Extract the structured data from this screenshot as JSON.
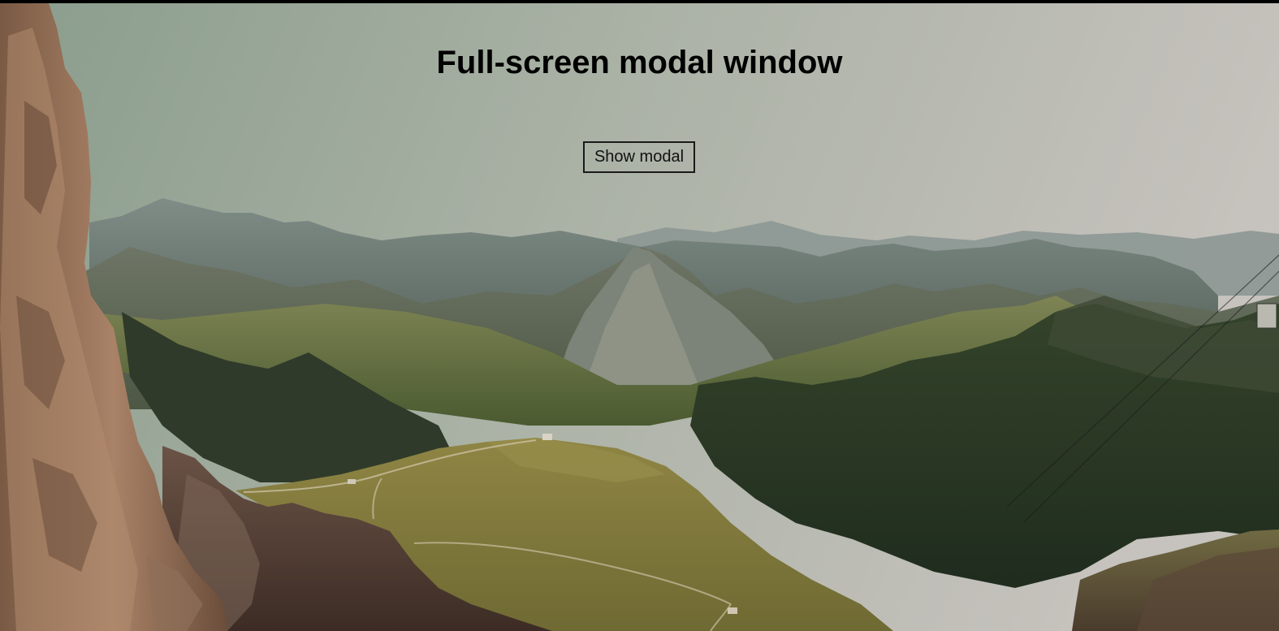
{
  "page": {
    "title": "Full-screen modal window",
    "show_modal_label": "Show modal"
  },
  "colors": {
    "sky_top": "#8d9f8e",
    "sky_bottom": "#c4c1bc",
    "text": "#000000",
    "button_border": "#1a1a1a"
  }
}
